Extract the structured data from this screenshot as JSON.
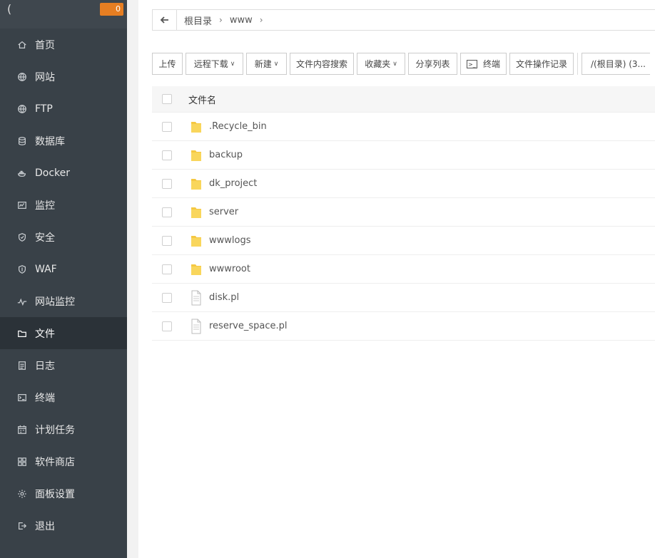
{
  "sidebar": {
    "badge": "0",
    "items": [
      {
        "label": "首页",
        "icon": "home-icon"
      },
      {
        "label": "网站",
        "icon": "globe-icon"
      },
      {
        "label": "FTP",
        "icon": "ftp-globe-icon"
      },
      {
        "label": "数据库",
        "icon": "database-icon"
      },
      {
        "label": "Docker",
        "icon": "docker-icon"
      },
      {
        "label": "监控",
        "icon": "monitor-icon"
      },
      {
        "label": "安全",
        "icon": "shield-icon"
      },
      {
        "label": "WAF",
        "icon": "waf-shield-icon"
      },
      {
        "label": "网站监控",
        "icon": "pulse-icon"
      },
      {
        "label": "文件",
        "icon": "folder-icon",
        "active": true
      },
      {
        "label": "日志",
        "icon": "log-icon"
      },
      {
        "label": "终端",
        "icon": "terminal-icon"
      },
      {
        "label": "计划任务",
        "icon": "calendar-icon"
      },
      {
        "label": "软件商店",
        "icon": "grid-icon"
      },
      {
        "label": "面板设置",
        "icon": "gear-icon"
      },
      {
        "label": "退出",
        "icon": "logout-icon"
      }
    ]
  },
  "path": {
    "back_icon": "arrow-left-icon",
    "crumbs": [
      "根目录",
      "www"
    ],
    "separator": "›"
  },
  "toolbar": {
    "upload": "上传",
    "remote_download": "远程下载",
    "new": "新建",
    "content_search": "文件内容搜索",
    "favorites": "收藏夹",
    "share_list": "分享列表",
    "terminal": "终端",
    "op_log": "文件操作记录",
    "disk": "/(根目录) (3..."
  },
  "table": {
    "header": "文件名",
    "rows": [
      {
        "name": ".Recycle_bin",
        "type": "folder"
      },
      {
        "name": "backup",
        "type": "folder"
      },
      {
        "name": "dk_project",
        "type": "folder"
      },
      {
        "name": "server",
        "type": "folder"
      },
      {
        "name": "wwwlogs",
        "type": "folder"
      },
      {
        "name": "wwwroot",
        "type": "folder"
      },
      {
        "name": "disk.pl",
        "type": "file"
      },
      {
        "name": "reserve_space.pl",
        "type": "file"
      }
    ]
  },
  "colors": {
    "sidebar_bg": "#394148",
    "sidebar_active": "#2b3238",
    "folder_yellow": "#f5c842",
    "badge_orange": "#e67e22"
  }
}
